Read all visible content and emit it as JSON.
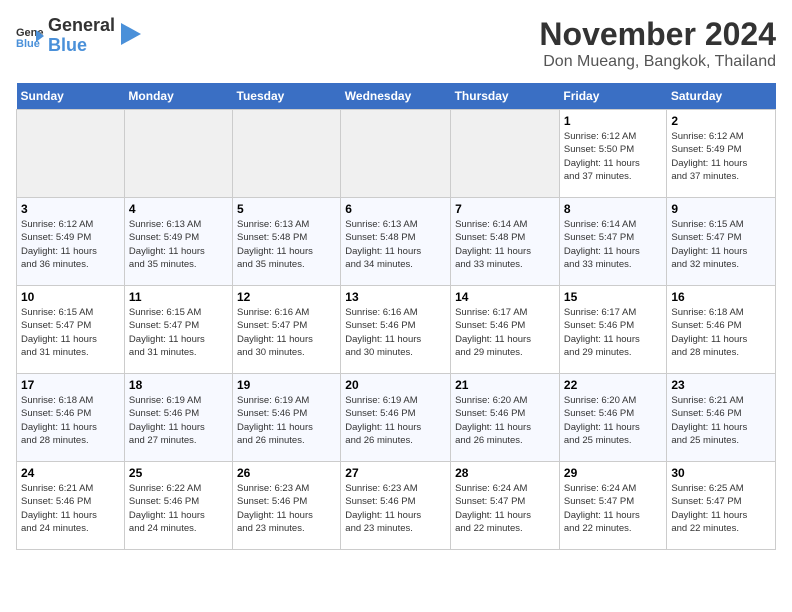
{
  "logo": {
    "line1": "General",
    "line2": "Blue"
  },
  "title": "November 2024",
  "location": "Don Mueang, Bangkok, Thailand",
  "weekdays": [
    "Sunday",
    "Monday",
    "Tuesday",
    "Wednesday",
    "Thursday",
    "Friday",
    "Saturday"
  ],
  "weeks": [
    [
      {
        "day": "",
        "info": ""
      },
      {
        "day": "",
        "info": ""
      },
      {
        "day": "",
        "info": ""
      },
      {
        "day": "",
        "info": ""
      },
      {
        "day": "",
        "info": ""
      },
      {
        "day": "1",
        "info": "Sunrise: 6:12 AM\nSunset: 5:50 PM\nDaylight: 11 hours\nand 37 minutes."
      },
      {
        "day": "2",
        "info": "Sunrise: 6:12 AM\nSunset: 5:49 PM\nDaylight: 11 hours\nand 37 minutes."
      }
    ],
    [
      {
        "day": "3",
        "info": "Sunrise: 6:12 AM\nSunset: 5:49 PM\nDaylight: 11 hours\nand 36 minutes."
      },
      {
        "day": "4",
        "info": "Sunrise: 6:13 AM\nSunset: 5:49 PM\nDaylight: 11 hours\nand 35 minutes."
      },
      {
        "day": "5",
        "info": "Sunrise: 6:13 AM\nSunset: 5:48 PM\nDaylight: 11 hours\nand 35 minutes."
      },
      {
        "day": "6",
        "info": "Sunrise: 6:13 AM\nSunset: 5:48 PM\nDaylight: 11 hours\nand 34 minutes."
      },
      {
        "day": "7",
        "info": "Sunrise: 6:14 AM\nSunset: 5:48 PM\nDaylight: 11 hours\nand 33 minutes."
      },
      {
        "day": "8",
        "info": "Sunrise: 6:14 AM\nSunset: 5:47 PM\nDaylight: 11 hours\nand 33 minutes."
      },
      {
        "day": "9",
        "info": "Sunrise: 6:15 AM\nSunset: 5:47 PM\nDaylight: 11 hours\nand 32 minutes."
      }
    ],
    [
      {
        "day": "10",
        "info": "Sunrise: 6:15 AM\nSunset: 5:47 PM\nDaylight: 11 hours\nand 31 minutes."
      },
      {
        "day": "11",
        "info": "Sunrise: 6:15 AM\nSunset: 5:47 PM\nDaylight: 11 hours\nand 31 minutes."
      },
      {
        "day": "12",
        "info": "Sunrise: 6:16 AM\nSunset: 5:47 PM\nDaylight: 11 hours\nand 30 minutes."
      },
      {
        "day": "13",
        "info": "Sunrise: 6:16 AM\nSunset: 5:46 PM\nDaylight: 11 hours\nand 30 minutes."
      },
      {
        "day": "14",
        "info": "Sunrise: 6:17 AM\nSunset: 5:46 PM\nDaylight: 11 hours\nand 29 minutes."
      },
      {
        "day": "15",
        "info": "Sunrise: 6:17 AM\nSunset: 5:46 PM\nDaylight: 11 hours\nand 29 minutes."
      },
      {
        "day": "16",
        "info": "Sunrise: 6:18 AM\nSunset: 5:46 PM\nDaylight: 11 hours\nand 28 minutes."
      }
    ],
    [
      {
        "day": "17",
        "info": "Sunrise: 6:18 AM\nSunset: 5:46 PM\nDaylight: 11 hours\nand 28 minutes."
      },
      {
        "day": "18",
        "info": "Sunrise: 6:19 AM\nSunset: 5:46 PM\nDaylight: 11 hours\nand 27 minutes."
      },
      {
        "day": "19",
        "info": "Sunrise: 6:19 AM\nSunset: 5:46 PM\nDaylight: 11 hours\nand 26 minutes."
      },
      {
        "day": "20",
        "info": "Sunrise: 6:19 AM\nSunset: 5:46 PM\nDaylight: 11 hours\nand 26 minutes."
      },
      {
        "day": "21",
        "info": "Sunrise: 6:20 AM\nSunset: 5:46 PM\nDaylight: 11 hours\nand 26 minutes."
      },
      {
        "day": "22",
        "info": "Sunrise: 6:20 AM\nSunset: 5:46 PM\nDaylight: 11 hours\nand 25 minutes."
      },
      {
        "day": "23",
        "info": "Sunrise: 6:21 AM\nSunset: 5:46 PM\nDaylight: 11 hours\nand 25 minutes."
      }
    ],
    [
      {
        "day": "24",
        "info": "Sunrise: 6:21 AM\nSunset: 5:46 PM\nDaylight: 11 hours\nand 24 minutes."
      },
      {
        "day": "25",
        "info": "Sunrise: 6:22 AM\nSunset: 5:46 PM\nDaylight: 11 hours\nand 24 minutes."
      },
      {
        "day": "26",
        "info": "Sunrise: 6:23 AM\nSunset: 5:46 PM\nDaylight: 11 hours\nand 23 minutes."
      },
      {
        "day": "27",
        "info": "Sunrise: 6:23 AM\nSunset: 5:46 PM\nDaylight: 11 hours\nand 23 minutes."
      },
      {
        "day": "28",
        "info": "Sunrise: 6:24 AM\nSunset: 5:47 PM\nDaylight: 11 hours\nand 22 minutes."
      },
      {
        "day": "29",
        "info": "Sunrise: 6:24 AM\nSunset: 5:47 PM\nDaylight: 11 hours\nand 22 minutes."
      },
      {
        "day": "30",
        "info": "Sunrise: 6:25 AM\nSunset: 5:47 PM\nDaylight: 11 hours\nand 22 minutes."
      }
    ]
  ]
}
